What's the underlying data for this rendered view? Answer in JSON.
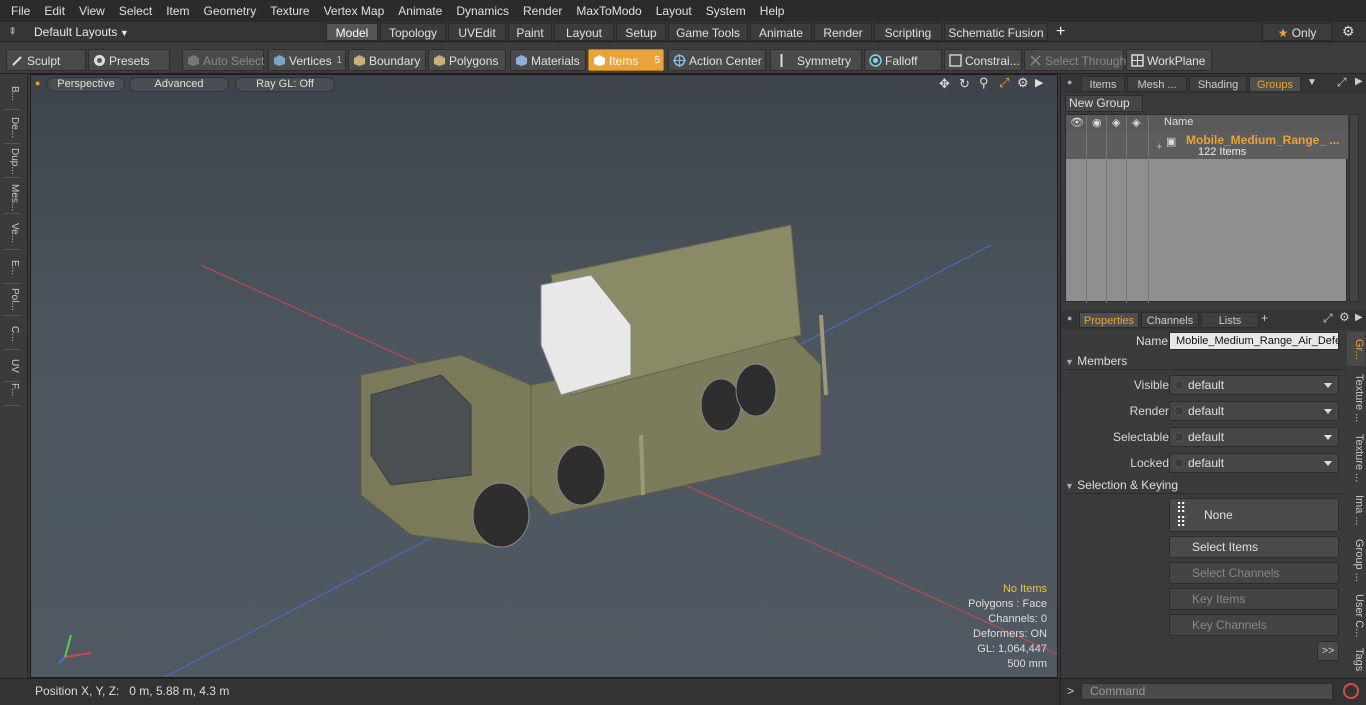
{
  "menu": [
    "File",
    "Edit",
    "View",
    "Select",
    "Item",
    "Geometry",
    "Texture",
    "Vertex Map",
    "Animate",
    "Dynamics",
    "Render",
    "MaxToModo",
    "Layout",
    "System",
    "Help"
  ],
  "layouts": {
    "label": "Default Layouts"
  },
  "mode_tabs": [
    "Model",
    "Topology",
    "UVEdit",
    "Paint",
    "Layout",
    "Setup",
    "Game Tools",
    "Animate",
    "Render",
    "Scripting",
    "Schematic Fusion"
  ],
  "only_label": "Only",
  "toolbar": {
    "sculpt": "Sculpt",
    "presets": "Presets",
    "auto_select": "Auto Select",
    "vertices": "Vertices",
    "vertices_count": "1",
    "boundary": "Boundary",
    "polygons": "Polygons",
    "materials": "Materials",
    "items": "Items",
    "items_count": "5",
    "action_center": "Action Center",
    "symmetry": "Symmetry",
    "falloff": "Falloff",
    "constraints": "Constrai...",
    "select_through": "Select Through",
    "workplane": "WorkPlane"
  },
  "left_tabs": [
    "B...",
    "De...",
    "Dup...",
    "Mes...",
    "Ve...",
    "E...",
    "Pol...",
    "C...",
    "UV",
    "F..."
  ],
  "viewport": {
    "view": "Perspective",
    "shading": "Advanced",
    "raygl": "Ray GL: Off",
    "stats": {
      "items": "No Items",
      "polygons": "Polygons : Face",
      "channels": "Channels: 0",
      "deformers": "Deformers: ON",
      "gl": "GL: 1,064,447",
      "scale": "500 mm"
    }
  },
  "status": {
    "position": "Position X, Y, Z:   0 m, 5.88 m, 4.3 m"
  },
  "groups_panel": {
    "tabs": [
      "Items",
      "Mesh ...",
      "Shading",
      "Groups"
    ],
    "new_group": "New Group",
    "col_name": "Name",
    "group_name": "Mobile_Medium_Range_ ...",
    "group_count": "122 Items"
  },
  "properties": {
    "tabs": [
      "Properties",
      "Channels",
      "Lists",
      "+"
    ],
    "name_label": "Name",
    "name_value": "Mobile_Medium_Range_Air_Defe",
    "members_label": "Members",
    "rows": [
      {
        "label": "Visible",
        "value": "default"
      },
      {
        "label": "Render",
        "value": "default"
      },
      {
        "label": "Selectable",
        "value": "default"
      },
      {
        "label": "Locked",
        "value": "default"
      }
    ],
    "selection_label": "Selection & Keying",
    "none": "None",
    "select_items": "Select Items",
    "select_channels": "Select Channels",
    "key_items": "Key Items",
    "key_channels": "Key Channels",
    "more": ">>",
    "side_tabs": [
      "Gr...",
      "Texture ...",
      "Texture ...",
      "Ima ...",
      "Group ...",
      "User C...",
      "Tags"
    ]
  },
  "command": {
    "placeholder": "Command"
  },
  "colors": {
    "accent": "#e8a33a",
    "panel": "#3b3b3b",
    "viewport": "#4a525a"
  }
}
